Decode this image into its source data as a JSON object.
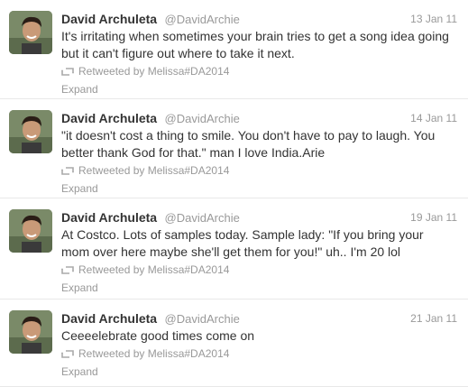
{
  "tweets": [
    {
      "name": "David Archuleta",
      "handle": "@DavidArchie",
      "date": "13 Jan 11",
      "text": "It's irritating when sometimes your brain tries to get a song idea going but it can't figure out where to take it next.",
      "retweet": "Retweeted by Melissa#DA2014",
      "expand": "Expand"
    },
    {
      "name": "David Archuleta",
      "handle": "@DavidArchie",
      "date": "14 Jan 11",
      "text": "\"it doesn't cost a thing to smile. You don't have to pay to laugh. You better thank God for that.\" man I love India.Arie",
      "retweet": "Retweeted by Melissa#DA2014",
      "expand": "Expand"
    },
    {
      "name": "David Archuleta",
      "handle": "@DavidArchie",
      "date": "19 Jan 11",
      "text": "At Costco. Lots of samples today. Sample lady: \"If you bring your mom over here maybe she'll get them for you!\" uh.. I'm 20 lol",
      "retweet": "Retweeted by Melissa#DA2014",
      "expand": "Expand"
    },
    {
      "name": "David Archuleta",
      "handle": "@DavidArchie",
      "date": "21 Jan 11",
      "text": "Ceeeelebrate good times come on",
      "retweet": "Retweeted by Melissa#DA2014",
      "expand": "Expand"
    }
  ],
  "colors": {
    "text": "#333333",
    "muted": "#999999",
    "divider": "#e8e8e8"
  },
  "icons": {
    "avatar": "profile-photo",
    "retweet": "retweet-icon"
  }
}
